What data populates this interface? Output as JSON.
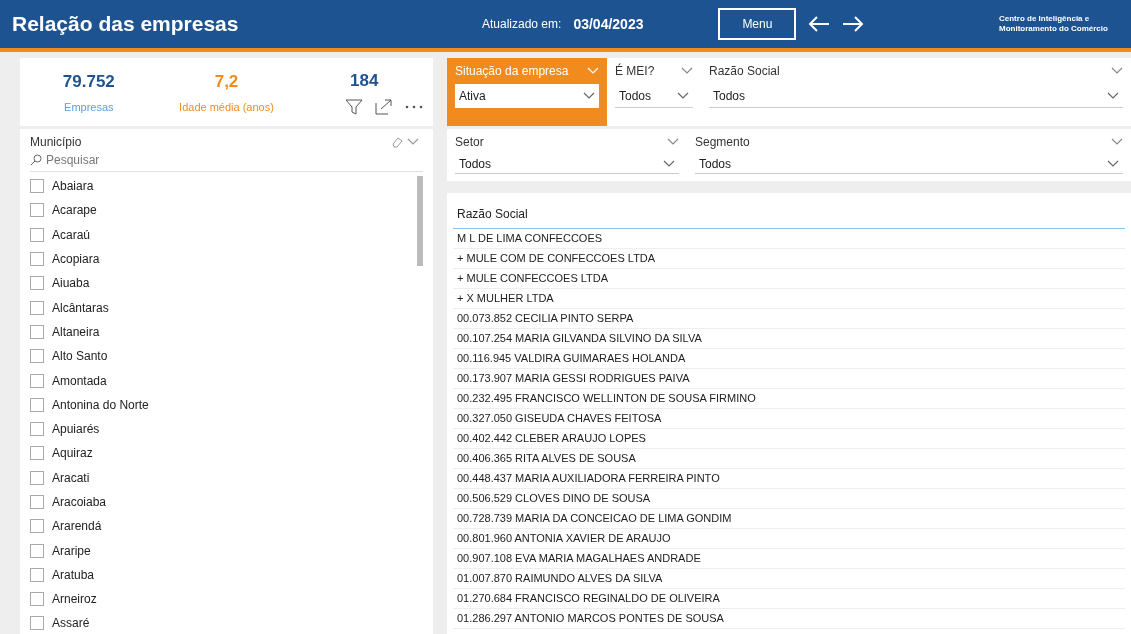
{
  "header": {
    "title": "Relação das empresas",
    "updated_label": "Atualizado em:",
    "updated_date": "03/04/2023",
    "menu_button": "Menu",
    "org_name": "Centro de Inteligência e Monitoramento do Comércio"
  },
  "kpis": [
    {
      "value": "79.752",
      "label": "Empresas",
      "color": "#1e5391"
    },
    {
      "value": "7,2",
      "label": "Idade média (anos)",
      "color": "#f28b1e"
    },
    {
      "value": "184"
    }
  ],
  "municipio_filter": {
    "title": "Município",
    "search_placeholder": "Pesquisar",
    "items": [
      {
        "label": "Abaiara",
        "checked": false
      },
      {
        "label": "Acarape",
        "checked": false
      },
      {
        "label": "Acaraú",
        "checked": false
      },
      {
        "label": "Acopiara",
        "checked": false
      },
      {
        "label": "Aiuaba",
        "checked": false
      },
      {
        "label": "Alcântaras",
        "checked": false
      },
      {
        "label": "Altaneira",
        "checked": false
      },
      {
        "label": "Alto Santo",
        "checked": false
      },
      {
        "label": "Amontada",
        "checked": false
      },
      {
        "label": "Antonina do Norte",
        "checked": false
      },
      {
        "label": "Apuiarés",
        "checked": false
      },
      {
        "label": "Aquiraz",
        "checked": false
      },
      {
        "label": "Aracati",
        "checked": false
      },
      {
        "label": "Aracoiaba",
        "checked": false
      },
      {
        "label": "Ararendá",
        "checked": false
      },
      {
        "label": "Araripe",
        "checked": false
      },
      {
        "label": "Aratuba",
        "checked": false
      },
      {
        "label": "Arneiroz",
        "checked": false
      },
      {
        "label": "Assaré",
        "checked": false
      }
    ]
  },
  "slicers_row_1": [
    {
      "title": "Situação da empresa",
      "value": "Ativa",
      "highlighted": true
    },
    {
      "title": "É MEI?",
      "value": "Todos",
      "highlighted": false
    },
    {
      "title": "Razão Social",
      "value": "Todos",
      "highlighted": false
    }
  ],
  "slicers_row_2": [
    {
      "title": "Setor",
      "value": "Todos"
    },
    {
      "title": "Segmento",
      "value": "Todos"
    }
  ],
  "table": {
    "column": "Razão Social",
    "rows": [
      "M L DE LIMA CONFECCOES",
      "+ MULE COM DE CONFECCOES LTDA",
      "+ MULE CONFECCOES LTDA",
      "+ X MULHER LTDA",
      "00.073.852 CECILIA PINTO SERPA",
      "00.107.254 MARIA GILVANDA SILVINO DA SILVA",
      "00.116.945 VALDIRA GUIMARAES HOLANDA",
      "00.173.907 MARIA GESSI RODRIGUES PAIVA",
      "00.232.495 FRANCISCO WELLINTON DE SOUSA FIRMINO",
      "00.327.050 GISEUDA CHAVES FEITOSA",
      "00.402.442 CLEBER ARAUJO LOPES",
      "00.406.365 RITA ALVES DE SOUSA",
      "00.448.437 MARIA AUXILIADORA FERREIRA PINTO",
      "00.506.529 CLOVES DINO DE SOUSA",
      "00.728.739 MARIA DA CONCEICAO DE LIMA GONDIM",
      "00.801.960 ANTONIA XAVIER DE ARAUJO",
      "00.907.108 EVA MARIA MAGALHAES ANDRADE",
      "01.007.870 RAIMUNDO ALVES DA SILVA",
      "01.270.684 FRANCISCO REGINALDO DE OLIVEIRA",
      "01.286.297 ANTONIO MARCOS PONTES DE SOUSA"
    ]
  }
}
